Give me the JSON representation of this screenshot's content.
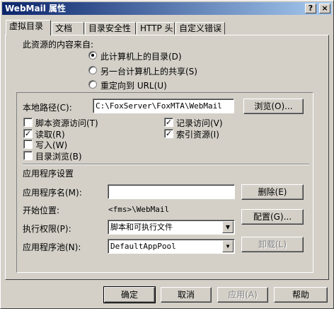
{
  "window": {
    "title": "WebMail 属性",
    "help_button": "?",
    "close_button": "×"
  },
  "tabs": [
    {
      "label": "虚拟目录",
      "active": true
    },
    {
      "label": "文档",
      "active": false
    },
    {
      "label": "目录安全性",
      "active": false
    },
    {
      "label": "HTTP 头",
      "active": false
    },
    {
      "label": "自定义错误",
      "active": false
    }
  ],
  "content_source": {
    "heading": "此资源的内容来自:",
    "options": [
      {
        "label": "此计算机上的目录(D)",
        "selected": true
      },
      {
        "label": "另一台计算机上的共享(S)",
        "selected": false
      },
      {
        "label": "重定向到 URL(U)",
        "selected": false
      }
    ]
  },
  "local_path": {
    "label": "本地路径(C):",
    "value": "C:\\FoxServer\\FoxMTA\\WebMail",
    "browse_button": "浏览(O)..."
  },
  "permissions": {
    "left": [
      {
        "label": "脚本资源访问(T)",
        "checked": false
      },
      {
        "label": "读取(R)",
        "checked": true
      },
      {
        "label": "写入(W)",
        "checked": false
      },
      {
        "label": "目录浏览(B)",
        "checked": false
      }
    ],
    "right": [
      {
        "label": "记录访问(V)",
        "checked": true
      },
      {
        "label": "索引资源(I)",
        "checked": true
      }
    ]
  },
  "app_settings": {
    "heading": "应用程序设置",
    "app_name_label": "应用程序名(M):",
    "app_name_value": "",
    "remove_button": "删除(E)",
    "start_point_label": "开始位置:",
    "start_point_value": "<fms>\\WebMail",
    "config_button": "配置(G)...",
    "exec_perm_label": "执行权限(P):",
    "exec_perm_value": "脚本和可执行文件",
    "app_pool_label": "应用程序池(N):",
    "app_pool_value": "DefaultAppPool",
    "unload_button": "卸载(L)"
  },
  "footer": {
    "ok": "确定",
    "cancel": "取消",
    "apply": "应用(A)",
    "help": "帮助"
  },
  "colors": {
    "face": "#d4d0c8",
    "title_start": "#0a246a",
    "title_end": "#a6caf0"
  }
}
